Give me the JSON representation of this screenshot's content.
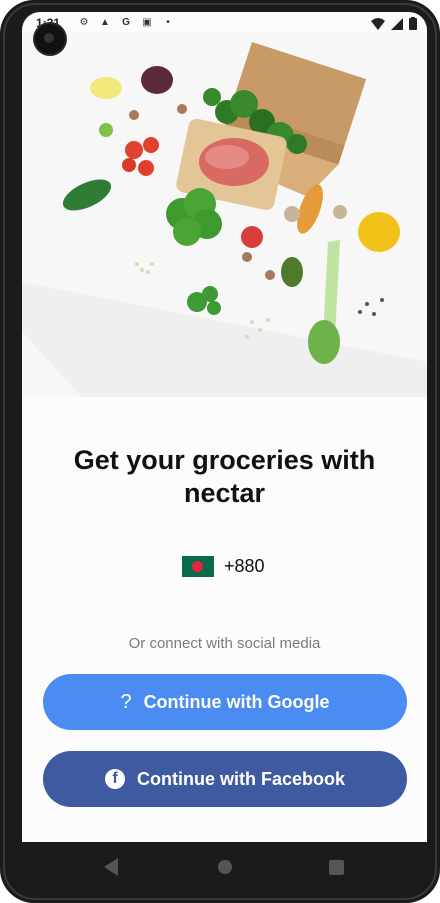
{
  "status_bar": {
    "time": "1:21",
    "icons_left": [
      "gear-icon",
      "android-auto-icon",
      "google-icon",
      "notification-icon",
      "dot-icon"
    ],
    "icons_right": [
      "wifi-icon",
      "signal-icon",
      "battery-icon"
    ]
  },
  "hero": {
    "image_name": "grocery-bag-with-vegetables"
  },
  "title": "Get your groceries with nectar",
  "phone": {
    "country_flag": "bangladesh-flag",
    "code": "+880"
  },
  "social_text": "Or connect with social media",
  "buttons": {
    "google": {
      "label": "Continue with Google",
      "icon": "?",
      "color": "#4a8cf2"
    },
    "facebook": {
      "label": "Continue with Facebook",
      "icon": "f",
      "color": "#3f5aa0"
    }
  },
  "nav": {
    "back": "back-icon",
    "home": "home-icon",
    "recent": "recents-icon"
  }
}
